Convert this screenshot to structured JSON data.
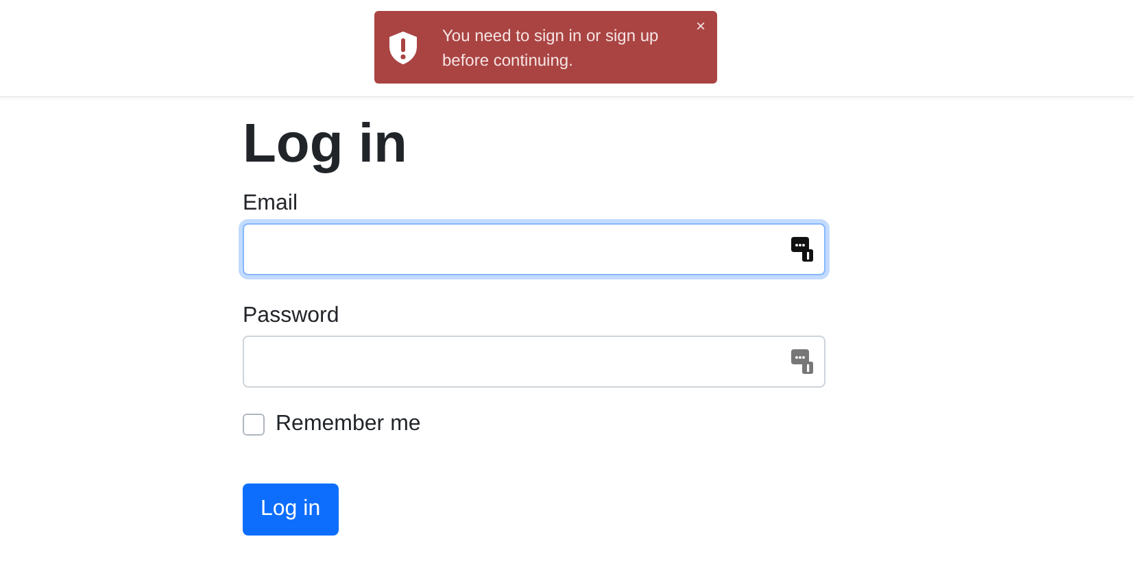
{
  "toast": {
    "message": "You need to sign in or sign up before continuing.",
    "close": "×"
  },
  "heading": "Log in",
  "fields": [
    {
      "label": "Email",
      "focused": true
    },
    {
      "label": "Password",
      "focused": false
    }
  ],
  "remember": {
    "label": "Remember me",
    "checked": false
  },
  "submit": "Log in"
}
